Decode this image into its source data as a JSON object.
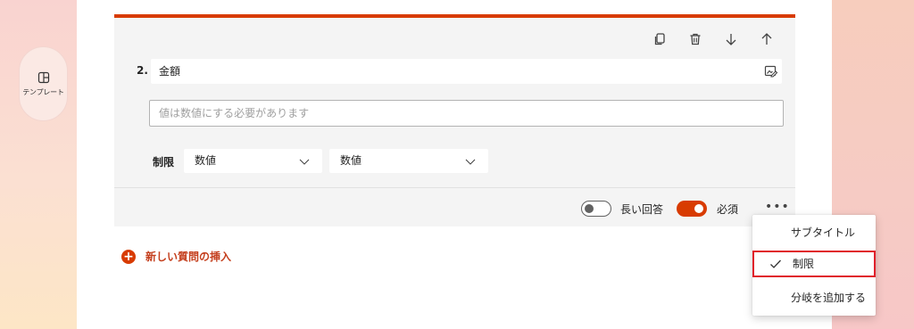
{
  "sidebar": {
    "template_label": "テンプレート"
  },
  "question": {
    "number": "2.",
    "title": "金額",
    "answer_placeholder": "値は数値にする必要があります",
    "limit_label": "制限",
    "limit_selects": [
      "数値",
      "数値"
    ],
    "toggles": {
      "long_answer": {
        "label": "長い回答",
        "on": false
      },
      "required": {
        "label": "必須",
        "on": true
      }
    },
    "more": "•••"
  },
  "add_question": {
    "plus": "+",
    "label": "新しい質問の挿入"
  },
  "menu": {
    "items": [
      {
        "label": "サブタイトル",
        "checked": false
      },
      {
        "label": "制限",
        "checked": true
      },
      {
        "label": "分岐を追加する",
        "checked": false
      }
    ]
  },
  "colors": {
    "accent": "#d83b01",
    "highlight": "#e0202b"
  },
  "icons": [
    "copy-icon",
    "delete-icon",
    "move-down-icon",
    "move-up-icon",
    "edit-image-icon",
    "chevron-down-icon",
    "check-icon",
    "template-icon"
  ]
}
